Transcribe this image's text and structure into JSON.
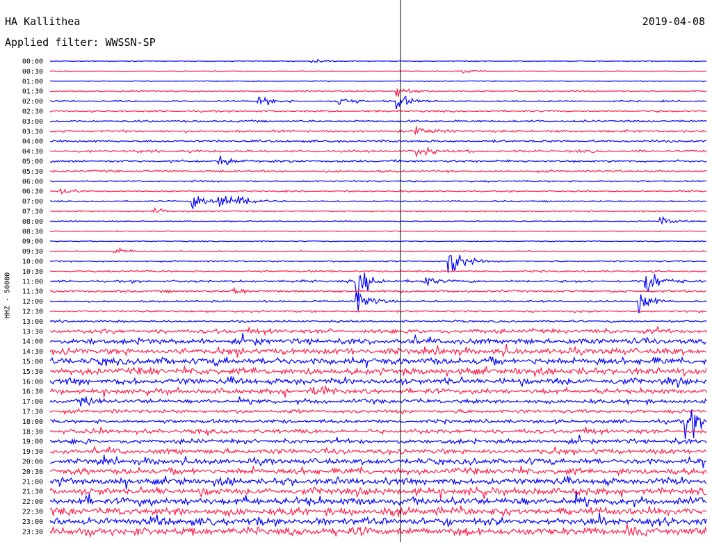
{
  "header": {
    "station": "HA Kallithea",
    "date": "2019-04-08",
    "filter": "Applied filter: WWSSN-SP"
  },
  "chart_data": {
    "type": "line",
    "title": "HA Kallithea",
    "date": "2019-04-08",
    "filter": "Applied filter: WWSSN-SP",
    "ylabel": "HHZ - 50000",
    "tick_labels": [
      "00:00",
      "00:30",
      "01:00",
      "01:30",
      "02:00",
      "02:30",
      "03:00",
      "03:30",
      "04:00",
      "04:30",
      "05:00",
      "05:30",
      "06:00",
      "06:30",
      "07:00",
      "07:30",
      "08:00",
      "08:30",
      "09:00",
      "09:30",
      "10:00",
      "10:30",
      "11:00",
      "11:30",
      "12:00",
      "12:30",
      "13:00",
      "13:30",
      "14:00",
      "14:30",
      "15:00",
      "15:30",
      "16:00",
      "16:30",
      "17:00",
      "17:30",
      "18:00",
      "18:30",
      "19:00",
      "19:30",
      "20:00",
      "20:30",
      "21:00",
      "21:30",
      "22:00",
      "22:30",
      "23:00",
      "23:30"
    ],
    "trace_colors": [
      "#0000ff",
      "#ff1e4b"
    ],
    "noise_level": [
      0.6,
      0.6,
      0.7,
      1.2,
      1.3,
      1.5,
      1.6,
      1.8,
      1.9,
      2.0,
      2.0,
      1.8,
      1.4,
      1.2,
      1.2,
      1.0,
      0.9,
      0.8,
      0.8,
      0.9,
      1.2,
      1.5,
      2.0,
      2.0,
      1.4,
      1.6,
      1.8,
      3.5,
      4.5,
      5.0,
      5.5,
      5.5,
      5.0,
      4.0,
      3.5,
      3.0,
      3.0,
      3.5,
      3.5,
      4.0,
      4.5,
      5.0,
      5.5,
      5.5,
      6.0,
      6.0,
      6.0,
      6.5
    ],
    "events": [
      {
        "row": 0,
        "t": 0.4,
        "amp": 6
      },
      {
        "row": 1,
        "t": 0.63,
        "amp": 5
      },
      {
        "row": 3,
        "t": 0.53,
        "amp": 12
      },
      {
        "row": 4,
        "t": 0.32,
        "amp": 10
      },
      {
        "row": 4,
        "t": 0.44,
        "amp": 14
      },
      {
        "row": 4,
        "t": 0.53,
        "amp": 16
      },
      {
        "row": 7,
        "t": 0.56,
        "amp": 10
      },
      {
        "row": 9,
        "t": 0.56,
        "amp": 12
      },
      {
        "row": 10,
        "t": 0.26,
        "amp": 10
      },
      {
        "row": 13,
        "t": 0.02,
        "amp": 6
      },
      {
        "row": 14,
        "t": 0.22,
        "amp": 18
      },
      {
        "row": 14,
        "t": 0.26,
        "amp": 18
      },
      {
        "row": 14,
        "t": 0.29,
        "amp": 14
      },
      {
        "row": 15,
        "t": 0.16,
        "amp": 6
      },
      {
        "row": 16,
        "t": 0.93,
        "amp": 8
      },
      {
        "row": 19,
        "t": 0.1,
        "amp": 6
      },
      {
        "row": 20,
        "t": 0.61,
        "amp": 35
      },
      {
        "row": 22,
        "t": 0.47,
        "amp": 30
      },
      {
        "row": 22,
        "t": 0.57,
        "amp": 10
      },
      {
        "row": 22,
        "t": 0.91,
        "amp": 30
      },
      {
        "row": 23,
        "t": 0.28,
        "amp": 8
      },
      {
        "row": 24,
        "t": 0.47,
        "amp": 22
      },
      {
        "row": 24,
        "t": 0.9,
        "amp": 20
      },
      {
        "row": 33,
        "t": 0.4,
        "amp": 14
      },
      {
        "row": 34,
        "t": 0.05,
        "amp": 10
      },
      {
        "row": 36,
        "t": 0.97,
        "amp": 40
      }
    ],
    "xlim": [
      0,
      1
    ],
    "grid": false,
    "legend": "none"
  }
}
